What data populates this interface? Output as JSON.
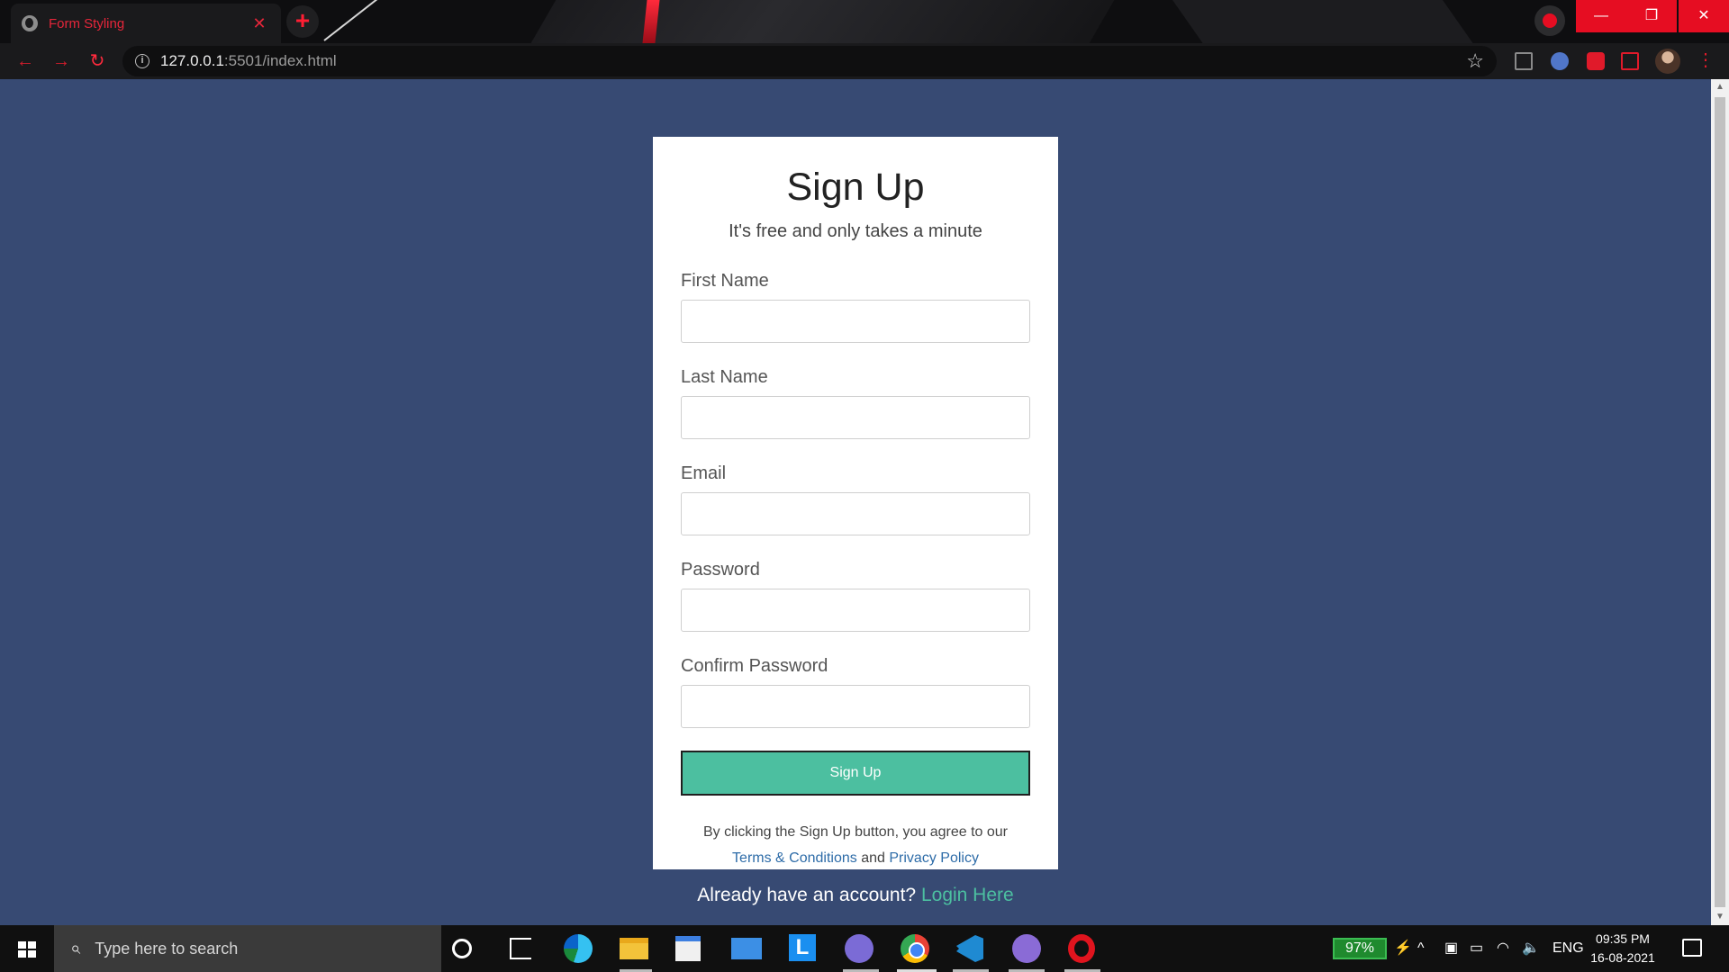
{
  "browser": {
    "tab_title": "Form Styling",
    "tab_close": "✕",
    "new_tab": "+",
    "url_host": "127.0.0.1",
    "url_rest": ":5501/index.html",
    "info_glyph": "i",
    "star_glyph": "☆",
    "back_glyph": "←",
    "forward_glyph": "→",
    "reload_glyph": "↻",
    "minimize_glyph": "—",
    "maximize_glyph": "❐",
    "close_glyph": "✕",
    "menu_glyph": "⋮",
    "accent_color": "#e60d22"
  },
  "form": {
    "title": "Sign Up",
    "subtitle": "It's free and only takes a minute",
    "fields": [
      {
        "label": "First Name",
        "value": ""
      },
      {
        "label": "Last Name",
        "value": ""
      },
      {
        "label": "Email",
        "value": ""
      },
      {
        "label": "Password",
        "value": ""
      },
      {
        "label": "Confirm Password",
        "value": ""
      }
    ],
    "submit_label": "Sign Up",
    "terms_prefix": "By clicking the Sign Up button, you agree to our",
    "terms_link": "Terms & Conditions",
    "terms_and": "and",
    "privacy_link": "Privacy Policy",
    "login_prompt": "Already have an account?",
    "login_link": "Login Here",
    "button_color": "#4cbfa0",
    "page_background": "#374a73"
  },
  "taskbar": {
    "search_placeholder": "Type here to search",
    "search_glyph": "⌕",
    "battery_percent": "97%",
    "language": "ENG",
    "time": "09:35 PM",
    "date": "16-08-2021",
    "l_app_letter": "L",
    "tray_up_glyph": "^"
  }
}
